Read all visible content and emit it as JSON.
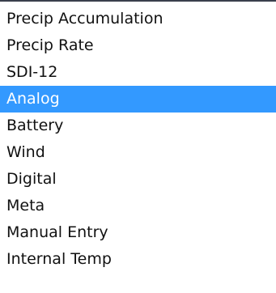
{
  "list": {
    "items": [
      {
        "label": "Precip Accumulation"
      },
      {
        "label": "Precip Rate"
      },
      {
        "label": "SDI-12"
      },
      {
        "label": "Analog"
      },
      {
        "label": "Battery"
      },
      {
        "label": "Wind"
      },
      {
        "label": "Digital"
      },
      {
        "label": "Meta"
      },
      {
        "label": "Manual Entry"
      },
      {
        "label": "Internal Temp"
      }
    ],
    "selected": "Analog"
  },
  "colors": {
    "selection_background": "#3399ff",
    "selection_text": "#ffffff",
    "text": "#111111",
    "border": "#3a3f4c"
  }
}
